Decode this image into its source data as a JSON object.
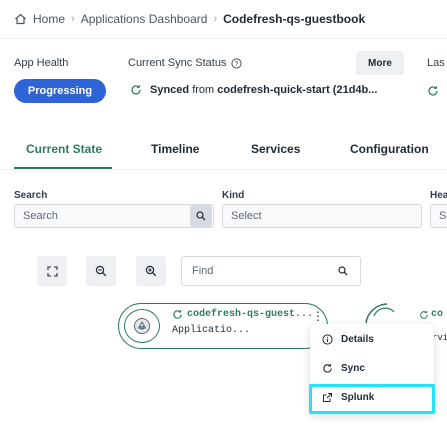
{
  "breadcrumb": {
    "home": "Home",
    "dashboard": "Applications Dashboard",
    "current": "Codefresh-qs-guestbook"
  },
  "health": {
    "label": "App Health",
    "status": "Progressing"
  },
  "sync": {
    "label": "Current Sync Status",
    "status": "Synced",
    "from_word": "from",
    "source": "codefresh-quick-start (21d4b...",
    "more_label": "More",
    "last_label": "Las"
  },
  "tabs": [
    {
      "label": "Current State",
      "active": true
    },
    {
      "label": "Timeline",
      "active": false
    },
    {
      "label": "Services",
      "active": false
    },
    {
      "label": "Configuration",
      "active": false
    }
  ],
  "filters": {
    "search_label": "Search",
    "search_placeholder": "Search",
    "kind_label": "Kind",
    "kind_placeholder": "Select",
    "health_label": "Hea",
    "health_placeholder": "Se"
  },
  "toolbar": {
    "find_placeholder": "Find"
  },
  "node": {
    "title": "codefresh-qs-guest...",
    "subtitle": "Applicatio...",
    "partial_title": "co",
    "partial_sub": "rvi"
  },
  "menu": {
    "details": "Details",
    "sync": "Sync",
    "splunk": "Splunk"
  },
  "colors": {
    "accent": "#2e7a62",
    "primary": "#2f63d8",
    "highlight": "#22e4f5"
  }
}
